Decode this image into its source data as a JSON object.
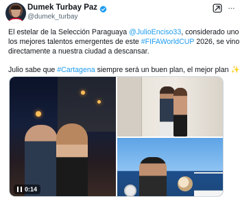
{
  "author": {
    "display_name": "Dumek Turbay Paz",
    "handle": "@dumek_turbay"
  },
  "tweet": {
    "paragraph1": {
      "text_before": "El estelar de la Selección Paraguaya ",
      "mention": "@JulioEnciso33",
      "text_mid1": ", considerado uno de",
      "text_line2": "los mejores talentos emergentes de este ",
      "hashtag": "#FIFAWorldCUP",
      "text_after": " 2026,  se vino",
      "text_line3": "directamente a nuestra ciudad a descansar."
    },
    "paragraph2": {
      "text_before": "Julio sabe que ",
      "hashtag": "#Cartagena",
      "text_after": " siempre será un buen plan, el mejor plan ",
      "emoji": "✨"
    }
  },
  "media": {
    "video": {
      "time": "0:14"
    }
  },
  "icons": {
    "verified": "verified-badge-icon",
    "grok": "grok-icon",
    "more": "more-options-icon",
    "pause": "pause-icon"
  },
  "colors": {
    "link": "#1d9bf0",
    "verified": "#1d9bf0",
    "secondary_text": "#536471"
  }
}
